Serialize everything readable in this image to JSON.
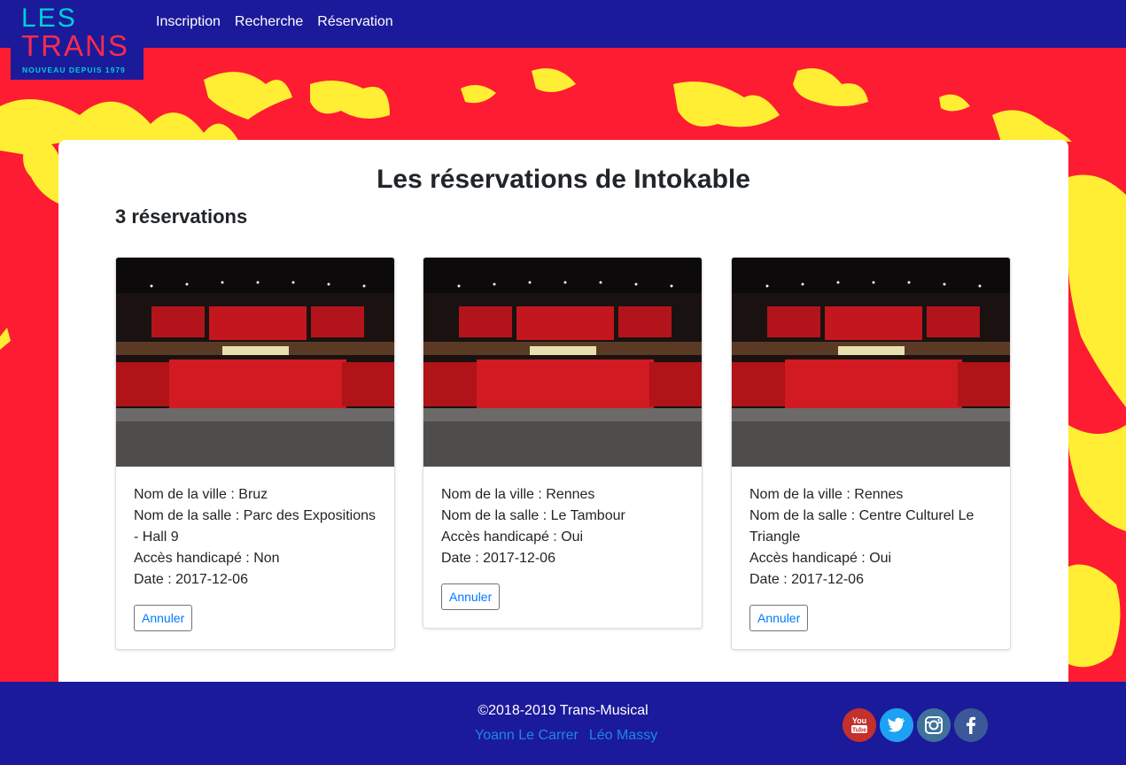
{
  "brand": {
    "logo_line1": "LES",
    "logo_line2": "TRANS",
    "tagline": "NOUVEAU DEPUIS 1979"
  },
  "nav": {
    "items": [
      {
        "label": "Inscription"
      },
      {
        "label": "Recherche"
      },
      {
        "label": "Réservation"
      }
    ]
  },
  "main": {
    "title": "Les réservations de Intokable",
    "count": "3 réservations",
    "cards": [
      {
        "ville": "Nom de la ville : Bruz",
        "salle": "Nom de la salle : Parc des Expositions - Hall 9",
        "acces": "Accès handicapé : Non",
        "date": "Date : 2017-12-06",
        "button": "Annuler"
      },
      {
        "ville": "Nom de la ville : Rennes",
        "salle": "Nom de la salle : Le Tambour",
        "acces": "Accès handicapé : Oui",
        "date": "Date : 2017-12-06",
        "button": "Annuler"
      },
      {
        "ville": "Nom de la ville : Rennes",
        "salle": "Nom de la salle : Centre Culturel Le Triangle",
        "acces": "Accès handicapé : Oui",
        "date": "Date : 2017-12-06",
        "button": "Annuler"
      }
    ]
  },
  "footer": {
    "copyright": "©2018-2019 Trans-Musical",
    "authors": [
      "Yoann Le Carrer",
      "Léo Massy"
    ],
    "socials": [
      {
        "icon": "youtube-icon",
        "text": "You Tube",
        "color": "#c4302b"
      },
      {
        "icon": "twitter-icon",
        "color": "#1da1f2"
      },
      {
        "icon": "instagram-icon",
        "color": "#3f729b"
      },
      {
        "icon": "facebook-icon",
        "text": "f",
        "color": "#3b5998"
      }
    ]
  },
  "colors": {
    "nav_bg": "#1b1a9b",
    "page_bg": "#fe1c32",
    "splatter": "#ffee33",
    "link_blue": "#007bff"
  }
}
